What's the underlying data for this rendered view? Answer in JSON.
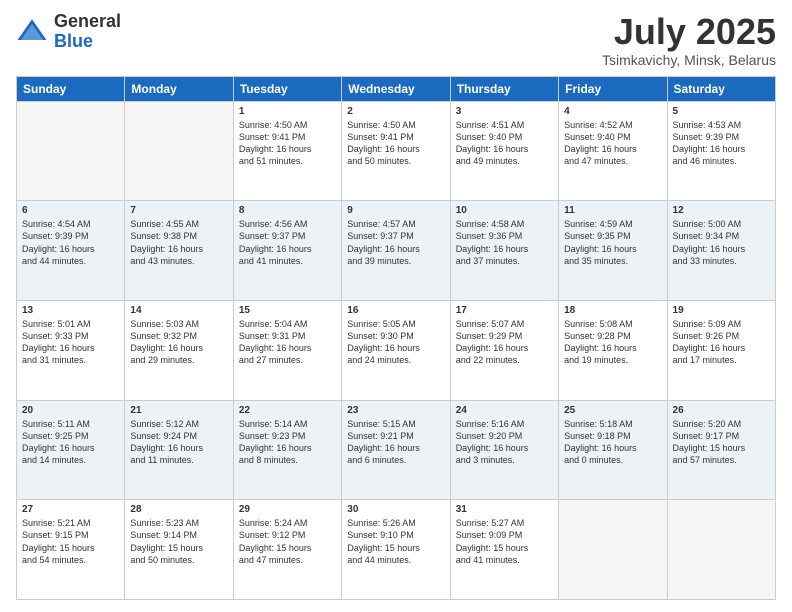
{
  "logo": {
    "general": "General",
    "blue": "Blue",
    "tagline": "▶"
  },
  "header": {
    "month": "July 2025",
    "location": "Tsimkavichy, Minsk, Belarus"
  },
  "weekdays": [
    "Sunday",
    "Monday",
    "Tuesday",
    "Wednesday",
    "Thursday",
    "Friday",
    "Saturday"
  ],
  "weeks": [
    [
      {
        "day": "",
        "info": ""
      },
      {
        "day": "",
        "info": ""
      },
      {
        "day": "1",
        "info": "Sunrise: 4:50 AM\nSunset: 9:41 PM\nDaylight: 16 hours\nand 51 minutes."
      },
      {
        "day": "2",
        "info": "Sunrise: 4:50 AM\nSunset: 9:41 PM\nDaylight: 16 hours\nand 50 minutes."
      },
      {
        "day": "3",
        "info": "Sunrise: 4:51 AM\nSunset: 9:40 PM\nDaylight: 16 hours\nand 49 minutes."
      },
      {
        "day": "4",
        "info": "Sunrise: 4:52 AM\nSunset: 9:40 PM\nDaylight: 16 hours\nand 47 minutes."
      },
      {
        "day": "5",
        "info": "Sunrise: 4:53 AM\nSunset: 9:39 PM\nDaylight: 16 hours\nand 46 minutes."
      }
    ],
    [
      {
        "day": "6",
        "info": "Sunrise: 4:54 AM\nSunset: 9:39 PM\nDaylight: 16 hours\nand 44 minutes."
      },
      {
        "day": "7",
        "info": "Sunrise: 4:55 AM\nSunset: 9:38 PM\nDaylight: 16 hours\nand 43 minutes."
      },
      {
        "day": "8",
        "info": "Sunrise: 4:56 AM\nSunset: 9:37 PM\nDaylight: 16 hours\nand 41 minutes."
      },
      {
        "day": "9",
        "info": "Sunrise: 4:57 AM\nSunset: 9:37 PM\nDaylight: 16 hours\nand 39 minutes."
      },
      {
        "day": "10",
        "info": "Sunrise: 4:58 AM\nSunset: 9:36 PM\nDaylight: 16 hours\nand 37 minutes."
      },
      {
        "day": "11",
        "info": "Sunrise: 4:59 AM\nSunset: 9:35 PM\nDaylight: 16 hours\nand 35 minutes."
      },
      {
        "day": "12",
        "info": "Sunrise: 5:00 AM\nSunset: 9:34 PM\nDaylight: 16 hours\nand 33 minutes."
      }
    ],
    [
      {
        "day": "13",
        "info": "Sunrise: 5:01 AM\nSunset: 9:33 PM\nDaylight: 16 hours\nand 31 minutes."
      },
      {
        "day": "14",
        "info": "Sunrise: 5:03 AM\nSunset: 9:32 PM\nDaylight: 16 hours\nand 29 minutes."
      },
      {
        "day": "15",
        "info": "Sunrise: 5:04 AM\nSunset: 9:31 PM\nDaylight: 16 hours\nand 27 minutes."
      },
      {
        "day": "16",
        "info": "Sunrise: 5:05 AM\nSunset: 9:30 PM\nDaylight: 16 hours\nand 24 minutes."
      },
      {
        "day": "17",
        "info": "Sunrise: 5:07 AM\nSunset: 9:29 PM\nDaylight: 16 hours\nand 22 minutes."
      },
      {
        "day": "18",
        "info": "Sunrise: 5:08 AM\nSunset: 9:28 PM\nDaylight: 16 hours\nand 19 minutes."
      },
      {
        "day": "19",
        "info": "Sunrise: 5:09 AM\nSunset: 9:26 PM\nDaylight: 16 hours\nand 17 minutes."
      }
    ],
    [
      {
        "day": "20",
        "info": "Sunrise: 5:11 AM\nSunset: 9:25 PM\nDaylight: 16 hours\nand 14 minutes."
      },
      {
        "day": "21",
        "info": "Sunrise: 5:12 AM\nSunset: 9:24 PM\nDaylight: 16 hours\nand 11 minutes."
      },
      {
        "day": "22",
        "info": "Sunrise: 5:14 AM\nSunset: 9:23 PM\nDaylight: 16 hours\nand 8 minutes."
      },
      {
        "day": "23",
        "info": "Sunrise: 5:15 AM\nSunset: 9:21 PM\nDaylight: 16 hours\nand 6 minutes."
      },
      {
        "day": "24",
        "info": "Sunrise: 5:16 AM\nSunset: 9:20 PM\nDaylight: 16 hours\nand 3 minutes."
      },
      {
        "day": "25",
        "info": "Sunrise: 5:18 AM\nSunset: 9:18 PM\nDaylight: 16 hours\nand 0 minutes."
      },
      {
        "day": "26",
        "info": "Sunrise: 5:20 AM\nSunset: 9:17 PM\nDaylight: 15 hours\nand 57 minutes."
      }
    ],
    [
      {
        "day": "27",
        "info": "Sunrise: 5:21 AM\nSunset: 9:15 PM\nDaylight: 15 hours\nand 54 minutes."
      },
      {
        "day": "28",
        "info": "Sunrise: 5:23 AM\nSunset: 9:14 PM\nDaylight: 15 hours\nand 50 minutes."
      },
      {
        "day": "29",
        "info": "Sunrise: 5:24 AM\nSunset: 9:12 PM\nDaylight: 15 hours\nand 47 minutes."
      },
      {
        "day": "30",
        "info": "Sunrise: 5:26 AM\nSunset: 9:10 PM\nDaylight: 15 hours\nand 44 minutes."
      },
      {
        "day": "31",
        "info": "Sunrise: 5:27 AM\nSunset: 9:09 PM\nDaylight: 15 hours\nand 41 minutes."
      },
      {
        "day": "",
        "info": ""
      },
      {
        "day": "",
        "info": ""
      }
    ]
  ]
}
